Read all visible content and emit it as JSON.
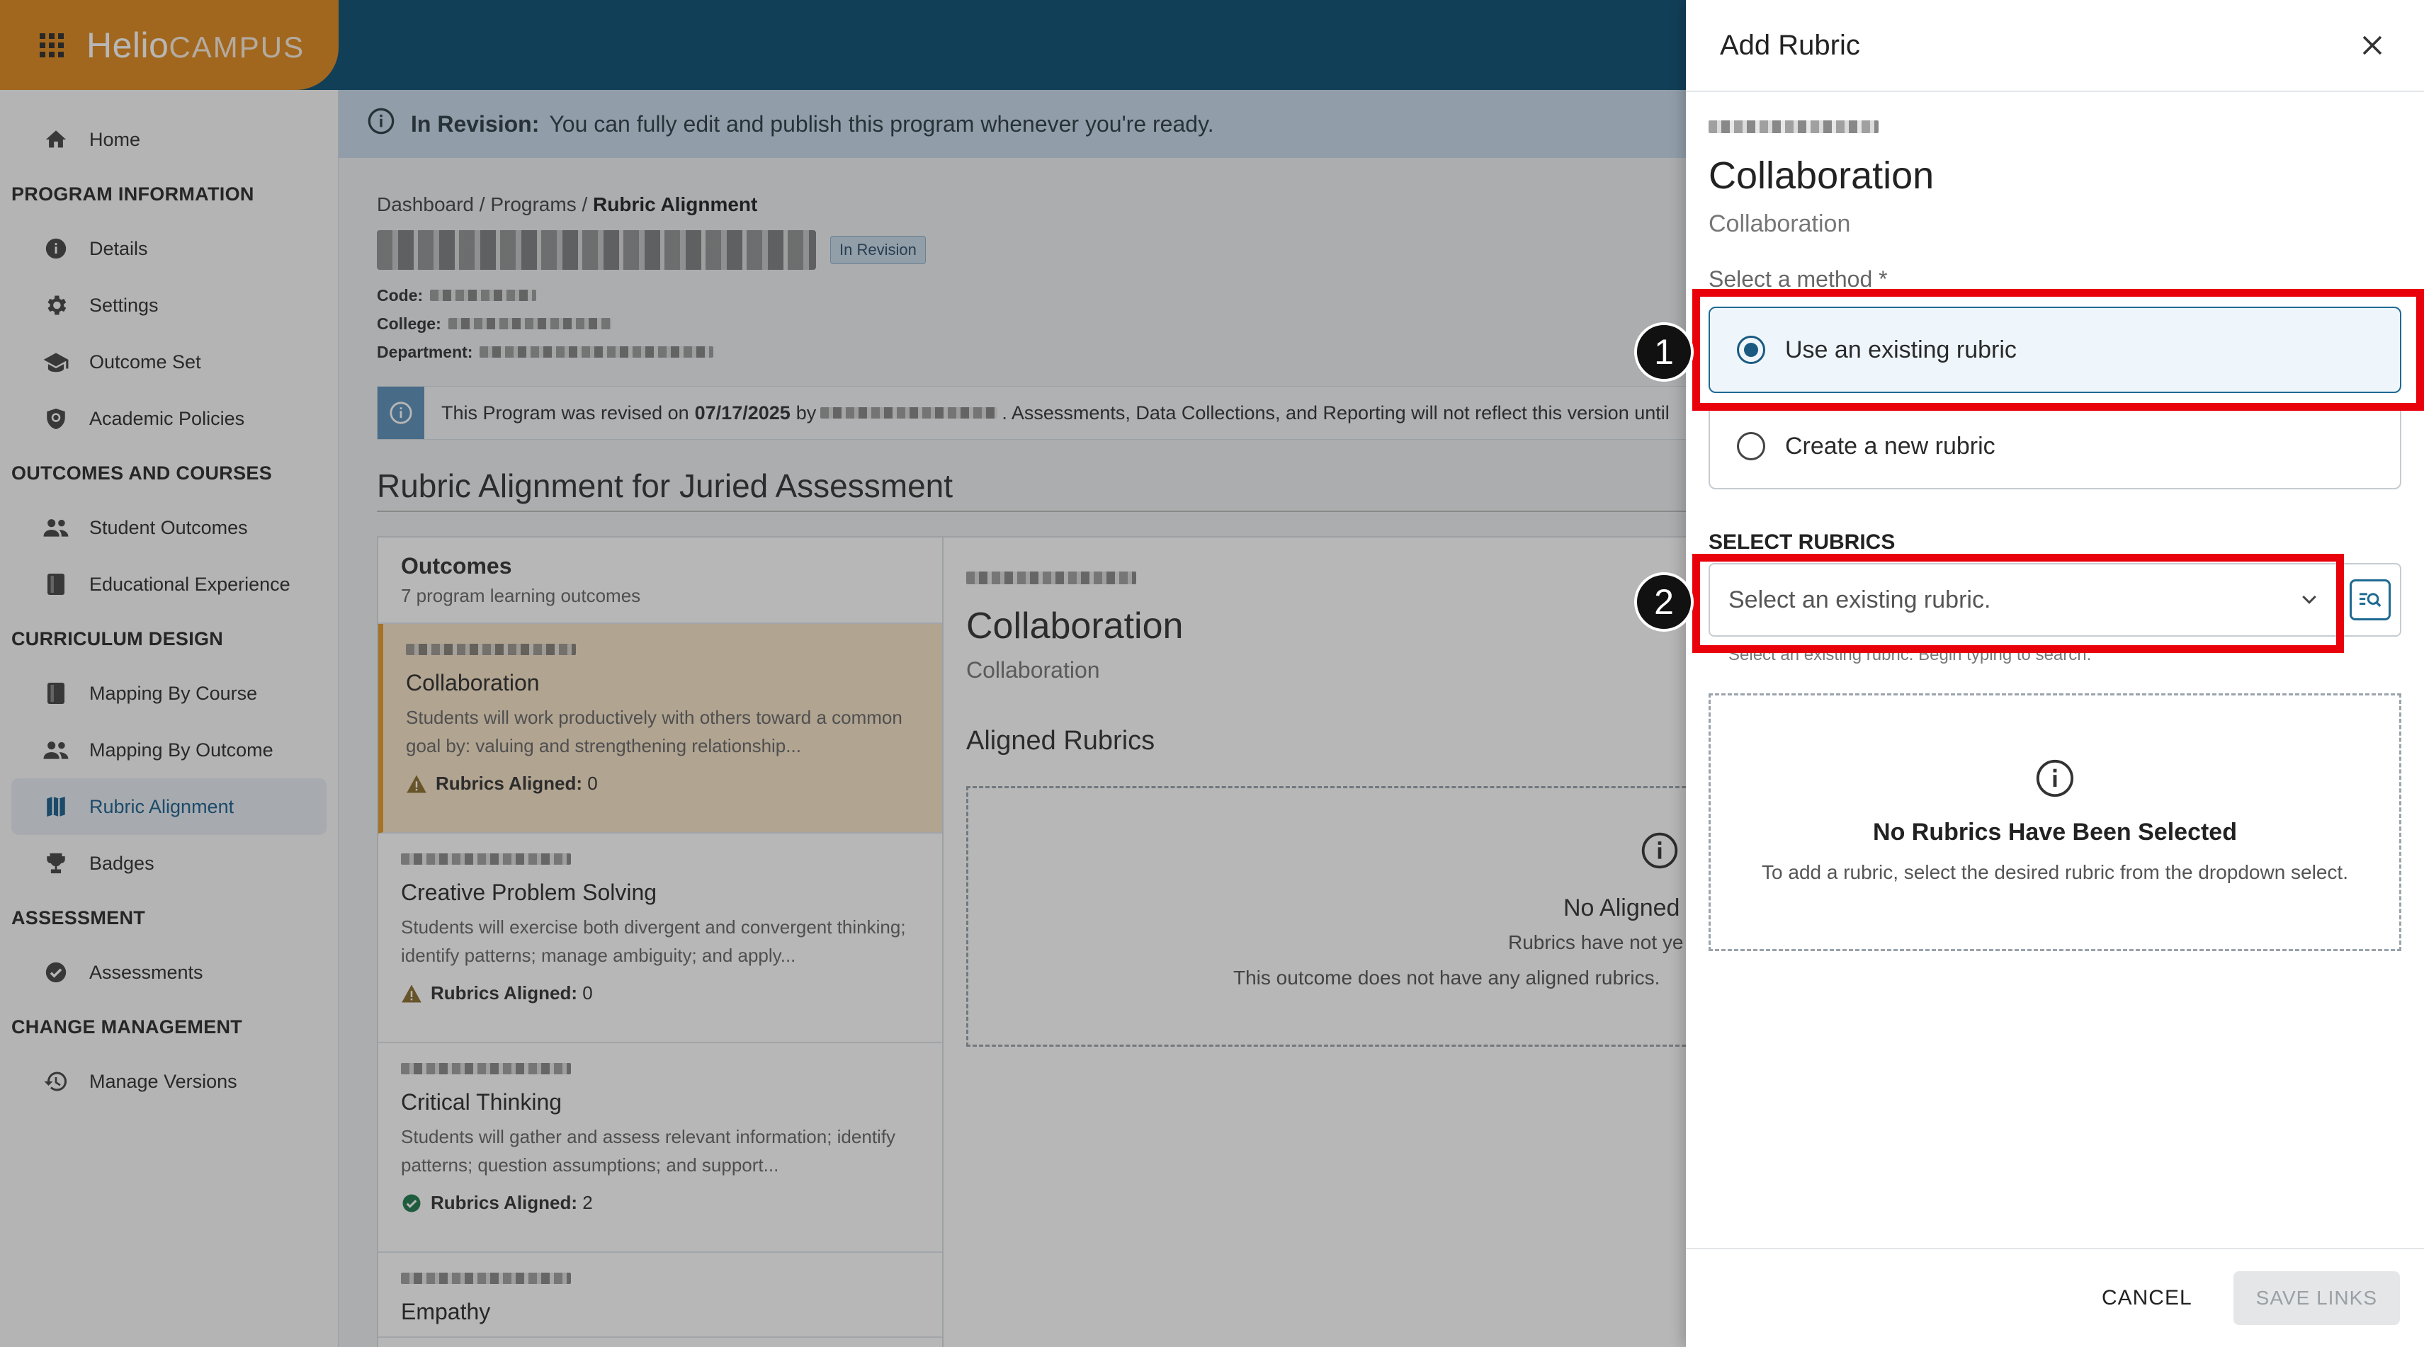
{
  "brand": {
    "logo_a": "Helio",
    "logo_b": "CAMPUS"
  },
  "sidebar": {
    "home": "Home",
    "sec_program": "PROGRAM INFORMATION",
    "details": "Details",
    "settings": "Settings",
    "outcome_set": "Outcome Set",
    "academic_policies": "Academic Policies",
    "sec_outcomes": "OUTCOMES AND COURSES",
    "student_outcomes": "Student Outcomes",
    "educational_experience": "Educational Experience",
    "sec_curriculum": "CURRICULUM DESIGN",
    "mapping_course": "Mapping By Course",
    "mapping_outcome": "Mapping By Outcome",
    "rubric_alignment": "Rubric Alignment",
    "badges": "Badges",
    "sec_assessment": "ASSESSMENT",
    "assessments": "Assessments",
    "sec_change": "CHANGE MANAGEMENT",
    "manage_versions": "Manage Versions"
  },
  "revision": {
    "label": "In Revision:",
    "text": "You can fully edit and publish this program whenever you're ready."
  },
  "breadcrumb": {
    "dashboard": "Dashboard /",
    "programs": "Programs /",
    "current": "Rubric Alignment"
  },
  "program": {
    "badge": "In Revision",
    "code_label": "Code:",
    "college_label": "College:",
    "department_label": "Department:"
  },
  "notice": {
    "pre": "This Program was revised on",
    "date": "07/17/2025",
    "by": "by",
    "post": ". Assessments, Data Collections, and Reporting will not reflect this version until"
  },
  "section_title": "Rubric Alignment for Juried Assessment",
  "outcomes": {
    "heading": "Outcomes",
    "subheading": "7 program learning outcomes",
    "items": [
      {
        "name": "Collaboration",
        "desc": "Students will work productively with others toward a common goal by: valuing and strengthening relationship...",
        "aligned_label": "Rubrics Aligned:",
        "aligned": "0"
      },
      {
        "name": "Creative Problem Solving",
        "desc": "Students will exercise both divergent and convergent thinking; identify patterns; manage ambiguity; and apply...",
        "aligned_label": "Rubrics Aligned:",
        "aligned": "0"
      },
      {
        "name": "Critical Thinking",
        "desc": "Students will gather and assess relevant information; identify patterns; question assumptions; and support...",
        "aligned_label": "Rubrics Aligned:",
        "aligned": "2"
      },
      {
        "name": "Empathy"
      }
    ]
  },
  "detail": {
    "name": "Collaboration",
    "sub": "Collaboration",
    "aligned_heading": "Aligned Rubrics",
    "empty_title": "No Aligned",
    "empty_line1": "Rubrics have not ye",
    "empty_line2": "This outcome does not have any aligned rubrics."
  },
  "drawer": {
    "title": "Add Rubric",
    "name": "Collaboration",
    "sub": "Collaboration",
    "method_label": "Select a method *",
    "opt_existing": "Use an existing rubric",
    "opt_new": "Create a new rubric",
    "select_heading": "SELECT RUBRICS",
    "select_placeholder": "Select an existing rubric.",
    "helper": "Select an existing rubric. Begin typing to search.",
    "empty_title": "No Rubrics Have Been Selected",
    "empty_text": "To add a rubric, select the desired rubric from the dropdown select.",
    "cancel": "CANCEL",
    "save": "SAVE LINKS"
  },
  "annotations": {
    "m1": "1",
    "m2": "2"
  },
  "colors": {
    "topbar": "#0d4f73",
    "brand": "#e08a1e",
    "highlight": "#e8000b",
    "accent": "#1e6a93"
  }
}
